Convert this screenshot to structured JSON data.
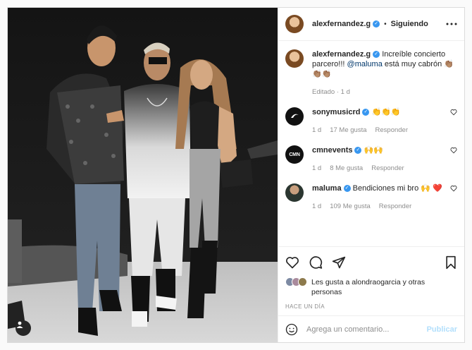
{
  "header": {
    "username": "alexfernandez.g",
    "separator": "•",
    "follow_status": "Siguiendo"
  },
  "caption": {
    "username": "alexfernandez.g",
    "text_pre": "Increíble concierto parcero!!! ",
    "mention": "@maluma",
    "text_post": " está muy cabrón 👏🏽👏🏽👏🏽",
    "meta": "Editado · 1 d"
  },
  "comments": [
    {
      "username": "sonymusicrd",
      "text": "👏👏👏",
      "time": "1 d",
      "likes": "17 Me gusta",
      "reply": "Responder"
    },
    {
      "username": "cmnevents",
      "text": "🙌🙌",
      "time": "1 d",
      "likes": "8 Me gusta",
      "reply": "Responder"
    },
    {
      "username": "maluma",
      "text": "Bendiciones mi bro 🙌 ❤️",
      "time": "1 d",
      "likes": "109 Me gusta",
      "reply": "Responder"
    }
  ],
  "likes_text": "Les gusta a alondraogarcia y otras personas",
  "timestamp": "Hace un día",
  "add_comment": {
    "placeholder": "Agrega un comentario...",
    "publish": "Publicar"
  },
  "colors": {
    "verified": "#3897f0",
    "mention": "#00376b",
    "publish_disabled": "#b2dffc",
    "heart": "#ed4956"
  },
  "icons": [
    "user-tag-icon",
    "more-options-icon",
    "heart-icon",
    "comment-icon",
    "share-icon",
    "bookmark-icon",
    "emoji-icon",
    "verified-badge-icon"
  ]
}
